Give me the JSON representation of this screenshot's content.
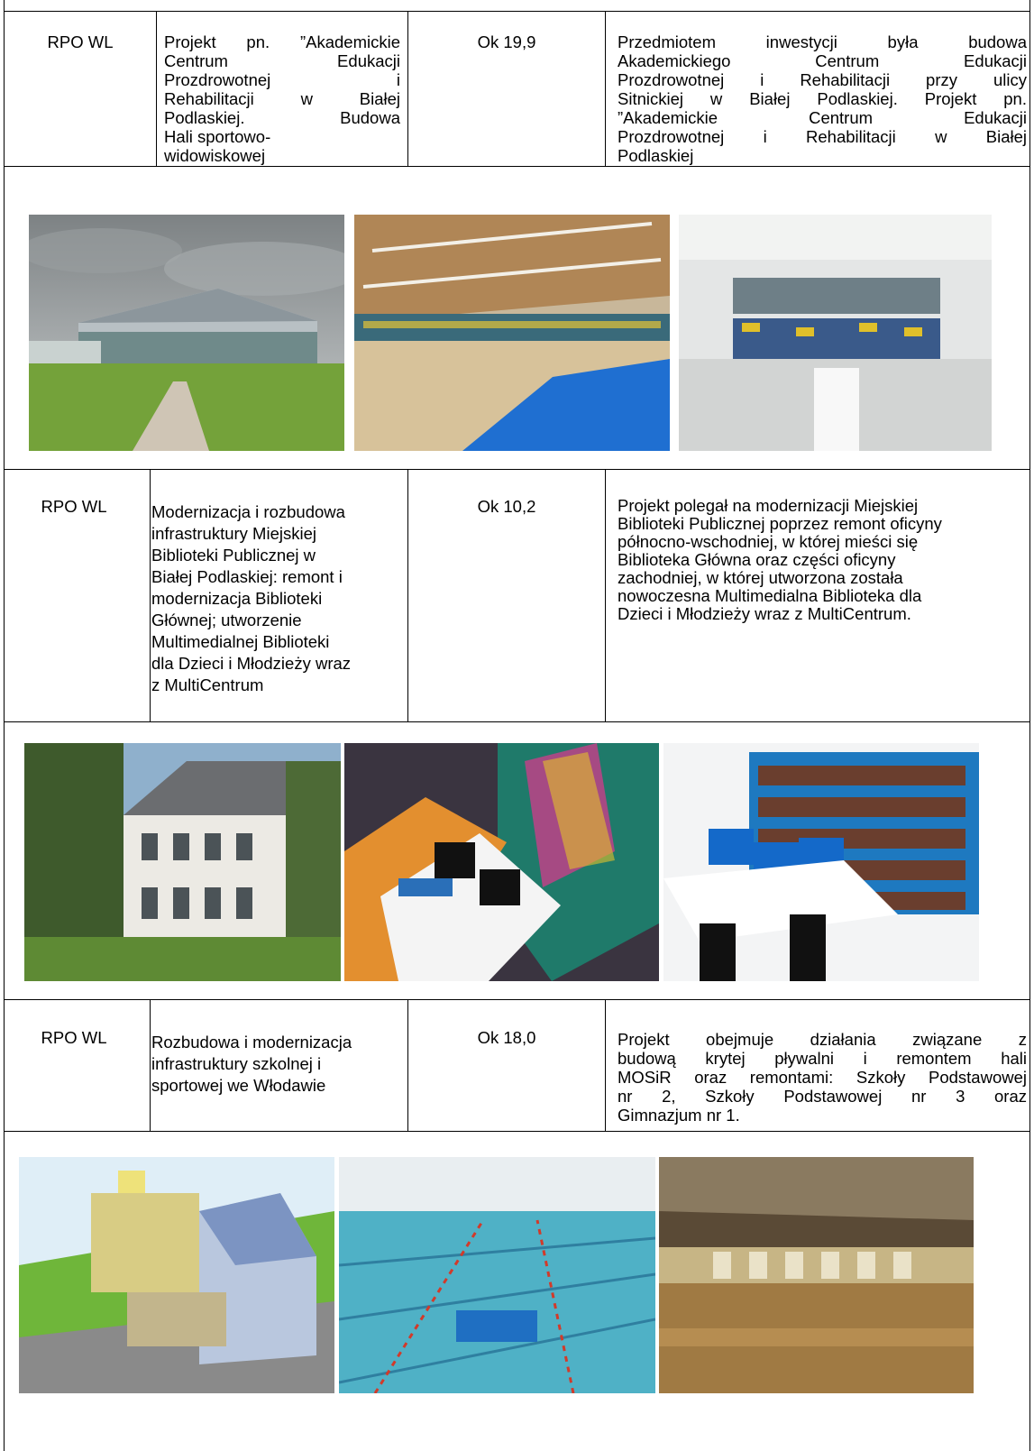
{
  "rows": [
    {
      "program": "RPO WL",
      "title_lines": [
        "Projekt pn. ”Akademickie",
        "Centrum Edukacji",
        "Prozdrowotnej i",
        "Rehabilitacji w Białej",
        "Podlaskiej. Budowa",
        "Hali sportowo-",
        "widowiskowej"
      ],
      "amount": "Ok 19,9",
      "description_lines": [
        "Przedmiotem inwestycji była budowa",
        "Akademickiego Centrum Edukacji",
        "Prozdrowotnej i Rehabilitacji przy ulicy",
        "Sitnickiej w Białej Podlaskiej. Projekt pn.",
        "”Akademickie Centrum Edukacji",
        "Prozdrowotnej i Rehabilitacji w Białej",
        "Podlaskiej"
      ],
      "photos": [
        "sports-hall-exterior-photo",
        "sports-hall-court-photo",
        "sports-hall-stands-photo"
      ]
    },
    {
      "program": "RPO WL",
      "title_lines": [
        "Modernizacja i rozbudowa",
        "infrastruktury Miejskiej",
        "Biblioteki Publicznej w",
        "Białej Podlaskiej: remont i",
        "modernizacja Biblioteki",
        "Głównej; utworzenie",
        "Multimedialnej Biblioteki",
        "dla Dzieci i Młodzieży wraz",
        "z MultiCentrum"
      ],
      "amount": "Ok 10,2",
      "description_lines": [
        "Projekt polegał na modernizacji Miejskiej",
        "Biblioteki Publicznej poprzez remont oficyny",
        "północno-wschodniej, w której mieści się",
        "Biblioteka Główna oraz części oficyny",
        "zachodniej, w której utworzona została",
        "nowoczesna Multimedialna Biblioteka dla",
        "Dzieci i Młodzieży wraz z MultiCentrum."
      ],
      "photos": [
        "library-building-photo",
        "multimedia-room-photo",
        "library-computers-photo"
      ]
    },
    {
      "program": "RPO WL",
      "title_lines": [
        "Rozbudowa i modernizacja",
        "infrastruktury szkolnej i",
        "sportowej we Włodawie"
      ],
      "amount": "Ok 18,0",
      "description_lines": [
        "Projekt obejmuje działania związane z",
        "budową krytej pływalni i remontem hali",
        "MOSiR oraz remontami: Szkoły Podstawowej",
        "nr 2, Szkoły Podstawowej nr 3 oraz",
        "Gimnazjum nr 1."
      ],
      "photos": [
        "school-rendering-photo",
        "swimming-pool-photo",
        "gym-hall-photo"
      ]
    }
  ]
}
